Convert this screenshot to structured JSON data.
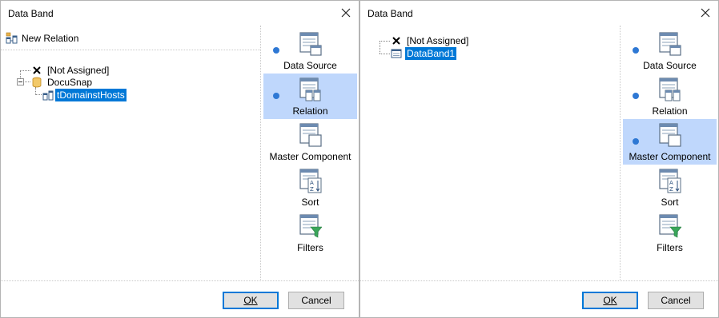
{
  "dialogs": [
    {
      "title": "Data Band",
      "toolbar": {
        "new_relation": "New Relation"
      },
      "tree": {
        "not_assigned": "[Not Assigned]",
        "datasource": "DocuSnap",
        "relation": "tDomainstHosts"
      },
      "nav": [
        "Data Source",
        "Relation",
        "Master Component",
        "Sort",
        "Filters"
      ],
      "active_nav": "Relation",
      "buttons": {
        "ok": "OK",
        "cancel": "Cancel"
      }
    },
    {
      "title": "Data Band",
      "tree": {
        "not_assigned": "[Not Assigned]",
        "component": "DataBand1"
      },
      "nav": [
        "Data Source",
        "Relation",
        "Master Component",
        "Sort",
        "Filters"
      ],
      "active_nav": "Master Component",
      "buttons": {
        "ok": "OK",
        "cancel": "Cancel"
      }
    }
  ],
  "colors": {
    "selection": "#0078d7",
    "nav_active": "#bfd7fc",
    "bullet": "#2e78d4"
  },
  "icons": {
    "close": "close-icon",
    "new_relation": "relation-icon",
    "not_assigned": "cross-icon",
    "datasource": "database-icon",
    "relation": "relation-icon",
    "component": "databand-icon",
    "nav": [
      "data-source-icon",
      "relation-icon",
      "master-component-icon",
      "sort-icon",
      "filter-icon"
    ]
  }
}
